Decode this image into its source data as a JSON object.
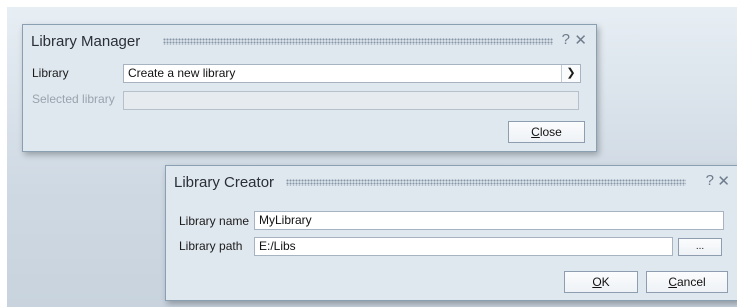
{
  "library_manager": {
    "title": "Library Manager",
    "help": "?",
    "close_x": "✕",
    "library_label": "Library",
    "library_value": "Create a new library",
    "selected_label": "Selected library",
    "selected_value": "",
    "close_button": {
      "mnemonic": "C",
      "rest": "lose"
    }
  },
  "library_creator": {
    "title": "Library Creator",
    "help": "?",
    "close_x": "✕",
    "name_label": "Library name",
    "name_value": "MyLibrary",
    "path_label": "Library path",
    "path_value": "E:/Libs",
    "browse_button": "...",
    "ok_button": {
      "mnemonic": "O",
      "rest": "K"
    },
    "cancel_button": {
      "mnemonic": "C",
      "rest": "ancel"
    }
  },
  "icons": {
    "dropdown": "chevron-down-icon",
    "close": "close-icon",
    "help": "help-icon"
  }
}
